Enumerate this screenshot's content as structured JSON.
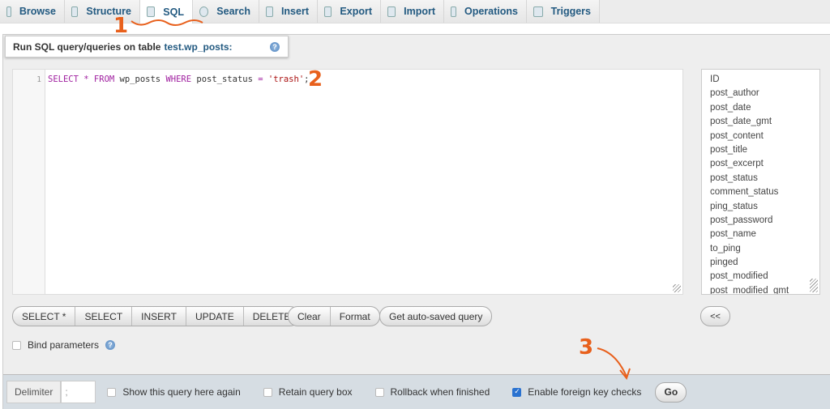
{
  "tabs": [
    {
      "label": "Browse",
      "icon": "browse-icon"
    },
    {
      "label": "Structure",
      "icon": "structure-icon"
    },
    {
      "label": "SQL",
      "icon": "sql-icon",
      "active": true
    },
    {
      "label": "Search",
      "icon": "search-icon"
    },
    {
      "label": "Insert",
      "icon": "insert-icon"
    },
    {
      "label": "Export",
      "icon": "export-icon"
    },
    {
      "label": "Import",
      "icon": "import-icon"
    },
    {
      "label": "Operations",
      "icon": "wrench-icon"
    },
    {
      "label": "Triggers",
      "icon": "triggers-icon"
    }
  ],
  "header": {
    "text": "Run SQL query/queries on table",
    "table": "test.wp_posts:"
  },
  "editor": {
    "line_number": "1",
    "query": "SELECT * FROM wp_posts WHERE post_status = 'trash';"
  },
  "columns": [
    "ID",
    "post_author",
    "post_date",
    "post_date_gmt",
    "post_content",
    "post_title",
    "post_excerpt",
    "post_status",
    "comment_status",
    "ping_status",
    "post_password",
    "post_name",
    "to_ping",
    "pinged",
    "post_modified",
    "post_modified_gmt"
  ],
  "query_buttons": [
    "SELECT *",
    "SELECT",
    "INSERT",
    "UPDATE",
    "DELETE"
  ],
  "edit_buttons": [
    "Clear",
    "Format"
  ],
  "autosave_button": "Get auto-saved query",
  "insert_column_button": "<<",
  "bind_parameters": {
    "label": "Bind parameters",
    "checked": false
  },
  "bottom": {
    "delimiter_label": "Delimiter",
    "delimiter_value": ";",
    "options": [
      {
        "label": "Show this query here again",
        "checked": false
      },
      {
        "label": "Retain query box",
        "checked": false
      },
      {
        "label": "Rollback when finished",
        "checked": false
      },
      {
        "label": "Enable foreign key checks",
        "checked": true
      }
    ],
    "go": "Go"
  },
  "annotations": [
    "1",
    "2",
    "3"
  ],
  "colors": {
    "annotation": "#e8601c",
    "link": "#235a81"
  }
}
